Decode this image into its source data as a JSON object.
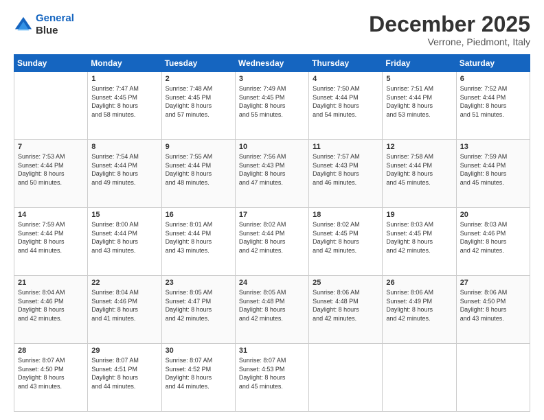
{
  "header": {
    "logo_line1": "General",
    "logo_line2": "Blue",
    "month": "December 2025",
    "location": "Verrone, Piedmont, Italy"
  },
  "days_of_week": [
    "Sunday",
    "Monday",
    "Tuesday",
    "Wednesday",
    "Thursday",
    "Friday",
    "Saturday"
  ],
  "weeks": [
    [
      {
        "day": "",
        "info": ""
      },
      {
        "day": "1",
        "info": "Sunrise: 7:47 AM\nSunset: 4:45 PM\nDaylight: 8 hours\nand 58 minutes."
      },
      {
        "day": "2",
        "info": "Sunrise: 7:48 AM\nSunset: 4:45 PM\nDaylight: 8 hours\nand 57 minutes."
      },
      {
        "day": "3",
        "info": "Sunrise: 7:49 AM\nSunset: 4:45 PM\nDaylight: 8 hours\nand 55 minutes."
      },
      {
        "day": "4",
        "info": "Sunrise: 7:50 AM\nSunset: 4:44 PM\nDaylight: 8 hours\nand 54 minutes."
      },
      {
        "day": "5",
        "info": "Sunrise: 7:51 AM\nSunset: 4:44 PM\nDaylight: 8 hours\nand 53 minutes."
      },
      {
        "day": "6",
        "info": "Sunrise: 7:52 AM\nSunset: 4:44 PM\nDaylight: 8 hours\nand 51 minutes."
      }
    ],
    [
      {
        "day": "7",
        "info": "Sunrise: 7:53 AM\nSunset: 4:44 PM\nDaylight: 8 hours\nand 50 minutes."
      },
      {
        "day": "8",
        "info": "Sunrise: 7:54 AM\nSunset: 4:44 PM\nDaylight: 8 hours\nand 49 minutes."
      },
      {
        "day": "9",
        "info": "Sunrise: 7:55 AM\nSunset: 4:44 PM\nDaylight: 8 hours\nand 48 minutes."
      },
      {
        "day": "10",
        "info": "Sunrise: 7:56 AM\nSunset: 4:43 PM\nDaylight: 8 hours\nand 47 minutes."
      },
      {
        "day": "11",
        "info": "Sunrise: 7:57 AM\nSunset: 4:43 PM\nDaylight: 8 hours\nand 46 minutes."
      },
      {
        "day": "12",
        "info": "Sunrise: 7:58 AM\nSunset: 4:44 PM\nDaylight: 8 hours\nand 45 minutes."
      },
      {
        "day": "13",
        "info": "Sunrise: 7:59 AM\nSunset: 4:44 PM\nDaylight: 8 hours\nand 45 minutes."
      }
    ],
    [
      {
        "day": "14",
        "info": "Sunrise: 7:59 AM\nSunset: 4:44 PM\nDaylight: 8 hours\nand 44 minutes."
      },
      {
        "day": "15",
        "info": "Sunrise: 8:00 AM\nSunset: 4:44 PM\nDaylight: 8 hours\nand 43 minutes."
      },
      {
        "day": "16",
        "info": "Sunrise: 8:01 AM\nSunset: 4:44 PM\nDaylight: 8 hours\nand 43 minutes."
      },
      {
        "day": "17",
        "info": "Sunrise: 8:02 AM\nSunset: 4:44 PM\nDaylight: 8 hours\nand 42 minutes."
      },
      {
        "day": "18",
        "info": "Sunrise: 8:02 AM\nSunset: 4:45 PM\nDaylight: 8 hours\nand 42 minutes."
      },
      {
        "day": "19",
        "info": "Sunrise: 8:03 AM\nSunset: 4:45 PM\nDaylight: 8 hours\nand 42 minutes."
      },
      {
        "day": "20",
        "info": "Sunrise: 8:03 AM\nSunset: 4:46 PM\nDaylight: 8 hours\nand 42 minutes."
      }
    ],
    [
      {
        "day": "21",
        "info": "Sunrise: 8:04 AM\nSunset: 4:46 PM\nDaylight: 8 hours\nand 42 minutes."
      },
      {
        "day": "22",
        "info": "Sunrise: 8:04 AM\nSunset: 4:46 PM\nDaylight: 8 hours\nand 41 minutes."
      },
      {
        "day": "23",
        "info": "Sunrise: 8:05 AM\nSunset: 4:47 PM\nDaylight: 8 hours\nand 42 minutes."
      },
      {
        "day": "24",
        "info": "Sunrise: 8:05 AM\nSunset: 4:48 PM\nDaylight: 8 hours\nand 42 minutes."
      },
      {
        "day": "25",
        "info": "Sunrise: 8:06 AM\nSunset: 4:48 PM\nDaylight: 8 hours\nand 42 minutes."
      },
      {
        "day": "26",
        "info": "Sunrise: 8:06 AM\nSunset: 4:49 PM\nDaylight: 8 hours\nand 42 minutes."
      },
      {
        "day": "27",
        "info": "Sunrise: 8:06 AM\nSunset: 4:50 PM\nDaylight: 8 hours\nand 43 minutes."
      }
    ],
    [
      {
        "day": "28",
        "info": "Sunrise: 8:07 AM\nSunset: 4:50 PM\nDaylight: 8 hours\nand 43 minutes."
      },
      {
        "day": "29",
        "info": "Sunrise: 8:07 AM\nSunset: 4:51 PM\nDaylight: 8 hours\nand 44 minutes."
      },
      {
        "day": "30",
        "info": "Sunrise: 8:07 AM\nSunset: 4:52 PM\nDaylight: 8 hours\nand 44 minutes."
      },
      {
        "day": "31",
        "info": "Sunrise: 8:07 AM\nSunset: 4:53 PM\nDaylight: 8 hours\nand 45 minutes."
      },
      {
        "day": "",
        "info": ""
      },
      {
        "day": "",
        "info": ""
      },
      {
        "day": "",
        "info": ""
      }
    ]
  ]
}
